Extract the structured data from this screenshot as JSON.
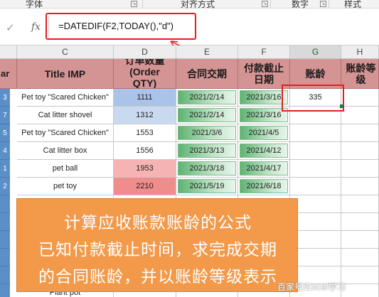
{
  "ribbon": {
    "groups": [
      "字体",
      "对齐方式",
      "数字",
      "样式"
    ]
  },
  "formula_bar": {
    "confirm_icon": "check-icon",
    "fx_label": "fx",
    "formula": "=DATEDIF(F2,TODAY(),\"d\")"
  },
  "sheet": {
    "columns": [
      "C",
      "D",
      "E",
      "F",
      "G",
      "H"
    ],
    "selected_column": "G",
    "headers": {
      "partial": "ar",
      "title": "Title IMP",
      "qty_line1": "订单数量",
      "qty_line2": "(Order",
      "qty_line3": "QTY)",
      "contract": "合同交期",
      "deadline_line1": "付款截止",
      "deadline_line2": "日期",
      "age": "账龄",
      "grade": "账龄等级"
    },
    "row_numbers": [
      "3",
      "7",
      "5",
      "4",
      "1",
      "2",
      "",
      "",
      "",
      "",
      "",
      ""
    ],
    "rows": [
      {
        "title": "Pet toy \"Scared Chicken\"",
        "qty": "1111",
        "contract": "2021/2/14",
        "deadline": "2021/3/16",
        "age": "335",
        "grade": ""
      },
      {
        "title": "Cat litter shovel",
        "qty": "1312",
        "contract": "2021/2/14",
        "deadline": "2021/3/16",
        "age": "",
        "grade": ""
      },
      {
        "title": "Pet toy \"Scared Chicken\"",
        "qty": "1553",
        "contract": "2021/3/6",
        "deadline": "2021/4/5",
        "age": "",
        "grade": ""
      },
      {
        "title": "Cat litter box",
        "qty": "1556",
        "contract": "2021/3/13",
        "deadline": "2021/4/12",
        "age": "",
        "grade": ""
      },
      {
        "title": "pet ball",
        "qty": "1953",
        "contract": "2021/3/18",
        "deadline": "2021/4/17",
        "age": "",
        "grade": ""
      },
      {
        "title": "pet toy",
        "qty": "2210",
        "contract": "2021/5/19",
        "deadline": "2021/6/18",
        "age": "",
        "grade": ""
      },
      {
        "title": "",
        "qty": "",
        "contract": "",
        "deadline": "",
        "age": "",
        "grade": ""
      },
      {
        "title": "",
        "qty": "",
        "contract": "",
        "deadline": "",
        "age": "",
        "grade": ""
      },
      {
        "title": "",
        "qty": "",
        "contract": "",
        "deadline": "",
        "age": "",
        "grade": ""
      },
      {
        "title": "",
        "qty": "",
        "contract": "",
        "deadline": "",
        "age": "",
        "grade": ""
      },
      {
        "title": "",
        "qty": "",
        "contract": "",
        "deadline": "",
        "age": "",
        "grade": ""
      },
      {
        "title": "Plant pot",
        "qty": "",
        "contract": "",
        "deadline": "",
        "age": "",
        "grade": ""
      }
    ],
    "qty_colors": [
      "#a9c4e8",
      "#c9d9f0",
      "#ffffff",
      "#ffffff",
      "#f6b3b3",
      "#f08c8c",
      "#ffffff",
      "#ffffff",
      "#ffffff",
      "#ffffff",
      "#ffffff",
      "#ffffff"
    ]
  },
  "overlay": {
    "line1": "计算应收账款账龄的公式",
    "line2": "已知付款截止时间，求完成交期",
    "line3": "的合同账龄，并以账龄等级表示"
  },
  "watermark": "百家号/Excel学习",
  "colors": {
    "highlight": "#e02020",
    "header_bg": "#d59494",
    "overlay_bg": "#f2994a",
    "date_green": "#5fb372"
  }
}
